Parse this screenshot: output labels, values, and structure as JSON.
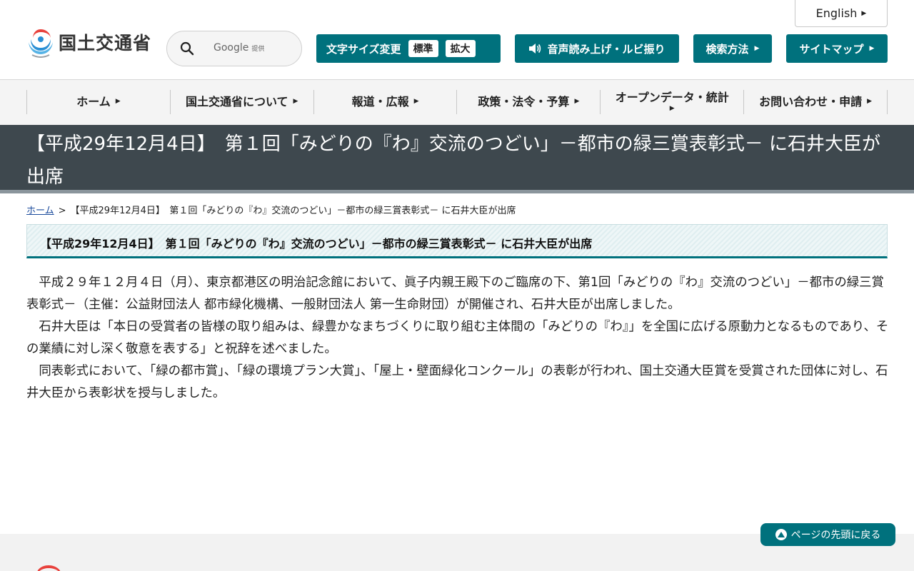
{
  "header": {
    "site_name": "国土交通省",
    "english_label": "English",
    "search": {
      "placeholder": "",
      "google_label": "Google",
      "google_suffix": "提供"
    },
    "font_size": {
      "label": "文字サイズ変更",
      "standard": "標準",
      "large": "拡大"
    },
    "voice_label": "音声読み上げ・ルビ振り",
    "search_howto_label": "検索方法",
    "sitemap_label": "サイトマップ"
  },
  "gnav": {
    "items": [
      {
        "label": "ホーム"
      },
      {
        "label": "国土交通省について"
      },
      {
        "label": "報道・広報"
      },
      {
        "label": "政策・法令・予算"
      },
      {
        "label": "オープンデータ・統計"
      },
      {
        "label": "お問い合わせ・申請"
      }
    ]
  },
  "page": {
    "title": "【平成29年12月4日】　第１回「みどりの『わ』交流のつどい」－都市の緑三賞表彰式－ に石井大臣が出席"
  },
  "breadcrumb": {
    "home": "ホーム",
    "separator": ">",
    "current": "【平成29年12月4日】　第１回「みどりの『わ』交流のつどい」－都市の緑三賞表彰式－ に石井大臣が出席"
  },
  "article": {
    "heading": "【平成29年12月4日】　第１回「みどりの『わ』交流のつどい」－都市の緑三賞表彰式－ に石井大臣が出席",
    "paragraphs": [
      "平成２９年１２月４日（月）、東京都港区の明治記念館において、眞子内親王殿下のご臨席の下、第1回「みどりの『わ』交流のつどい」－都市の緑三賞表彰式－（主催：公益財団法人 都市緑化機構、一般財団法人 第一生命財団）が開催され、石井大臣が出席しました。",
      "石井大臣は「本日の受賞者の皆様の取り組みは、緑豊かなまちづくりに取り組む主体間の「みどりの『わ』」を全国に広げる原動力となるものであり、その業績に対し深く敬意を表する」と祝辞を述べました。",
      "同表彰式において、「緑の都市賞」、「緑の環境プラン大賞」、「屋上・壁面緑化コンクール」の表彰が行われ、国土交通大臣賞を受賞された団体に対し、石井大臣から表彰状を授与しました。"
    ]
  },
  "pagetop_label": "ページの先頭に戻る",
  "colors": {
    "brand_teal": "#00717d",
    "title_band": "#3e484e",
    "link_blue": "#1a4a9c"
  }
}
